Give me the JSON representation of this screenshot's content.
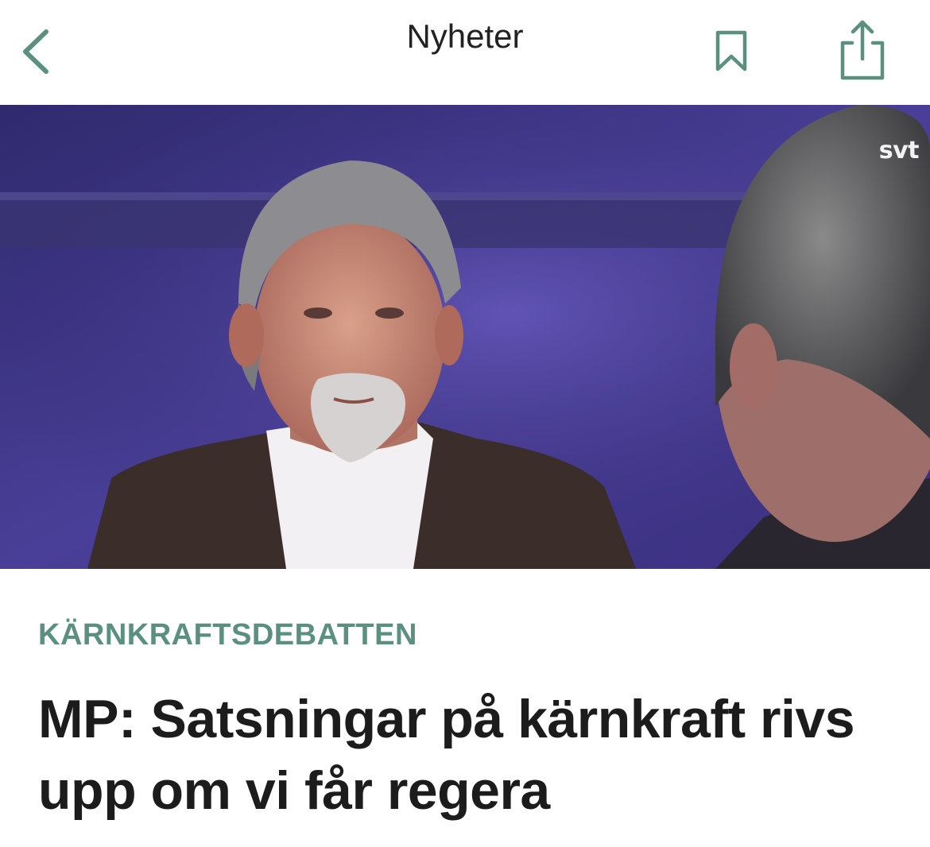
{
  "navbar": {
    "title": "Nyheter",
    "back_icon": "chevron-left-icon",
    "bookmark_icon": "bookmark-icon",
    "share_icon": "share-icon",
    "accent_color": "#5b8f80"
  },
  "hero": {
    "watermark": "svt"
  },
  "article": {
    "kicker": "KÄRNKRAFTSDEBATTEN",
    "headline": "MP: Satsningar på kärnkraft rivs upp om vi får regera",
    "kicker_color": "#5b8f80",
    "headline_color": "#1c1c1c"
  }
}
